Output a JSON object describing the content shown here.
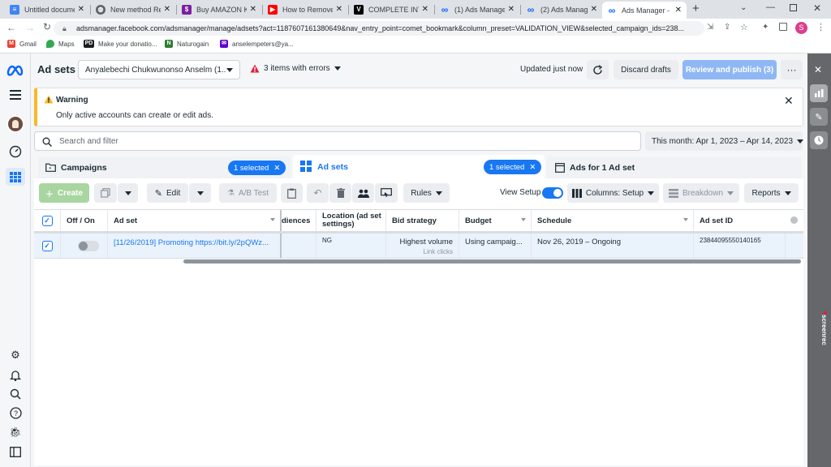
{
  "browser": {
    "tabs": [
      {
        "title": "Untitled documen",
        "icon": "docs-icon",
        "color": "#4285f4"
      },
      {
        "title": "New method Rev",
        "icon": "globe-icon",
        "color": "#5f6368"
      },
      {
        "title": "Buy AMAZON KD",
        "icon": "store-icon",
        "color": "#7b1fa2"
      },
      {
        "title": "How to Remove A",
        "icon": "youtube-icon",
        "color": "#ff0000"
      },
      {
        "title": "COMPLETE INTRO",
        "icon": "v-icon",
        "color": "#000000"
      },
      {
        "title": "(1) Ads Manager",
        "icon": "meta-icon",
        "color": "#0866ff"
      },
      {
        "title": "(2) Ads Manager",
        "icon": "meta-icon",
        "color": "#0866ff"
      },
      {
        "title": "Ads Manager - M",
        "icon": "meta-icon",
        "color": "#0866ff"
      }
    ],
    "url": "adsmanager.facebook.com/adsmanager/manage/adsets?act=1187607161380649&nav_entry_point=comet_bookmark&column_preset=VALIDATION_VIEW&selected_campaign_ids=238...",
    "profile_initial": "S",
    "bookmarks": [
      {
        "label": "Gmail",
        "icon": "gmail-icon"
      },
      {
        "label": "Maps",
        "icon": "maps-icon"
      },
      {
        "label": "Make your donatio...",
        "icon": "pd-icon"
      },
      {
        "label": "Naturogain",
        "icon": "naturogain-icon"
      },
      {
        "label": "anselempeters@ya...",
        "icon": "yahoo-icon"
      }
    ]
  },
  "header": {
    "title": "Ad sets",
    "account": "Anyalebechi Chukwunonso Anselm (1...",
    "errors": "3 items with errors",
    "updated": "Updated just now",
    "discard": "Discard drafts",
    "publish": "Review and publish (3)"
  },
  "alert": {
    "title": "Warning",
    "message": "Only active accounts can create or edit ads."
  },
  "search": {
    "placeholder": "Search and filter",
    "date_range": "This month: Apr 1, 2023 – Apr 14, 2023"
  },
  "level_tabs": [
    {
      "label": "Campaigns",
      "selected": "1 selected"
    },
    {
      "label": "Ad sets",
      "selected": "1 selected"
    },
    {
      "label": "Ads for 1 Ad set"
    }
  ],
  "toolbar": {
    "create": "Create",
    "edit": "Edit",
    "ab_test": "A/B Test",
    "rules": "Rules",
    "view_setup": "View Setup",
    "columns": "Columns: Setup",
    "breakdown": "Breakdown",
    "reports": "Reports"
  },
  "table": {
    "columns": [
      "Off / On",
      "Ad set",
      "diences",
      "Location (ad set settings)",
      "Bid strategy",
      "Budget",
      "Schedule",
      "Ad set ID"
    ],
    "rows": [
      {
        "on": false,
        "ad_set": "[11/26/2019] Promoting https://bit.ly/2pQWz...",
        "audiences": "",
        "location": "NG",
        "bid_strategy": "Highest volume",
        "bid_sub": "Link clicks",
        "budget": "Using campaig...",
        "schedule": "Nov 26, 2019 – Ongoing",
        "ad_set_id": "23844095550140165"
      }
    ]
  },
  "watermark": "screenrec",
  "colors": {
    "accent": "#1877f2",
    "publish_disabled": "#8fb7f5",
    "create_disabled": "#a8d5a0",
    "warning": "#f7b928",
    "error": "#e41e3f"
  }
}
